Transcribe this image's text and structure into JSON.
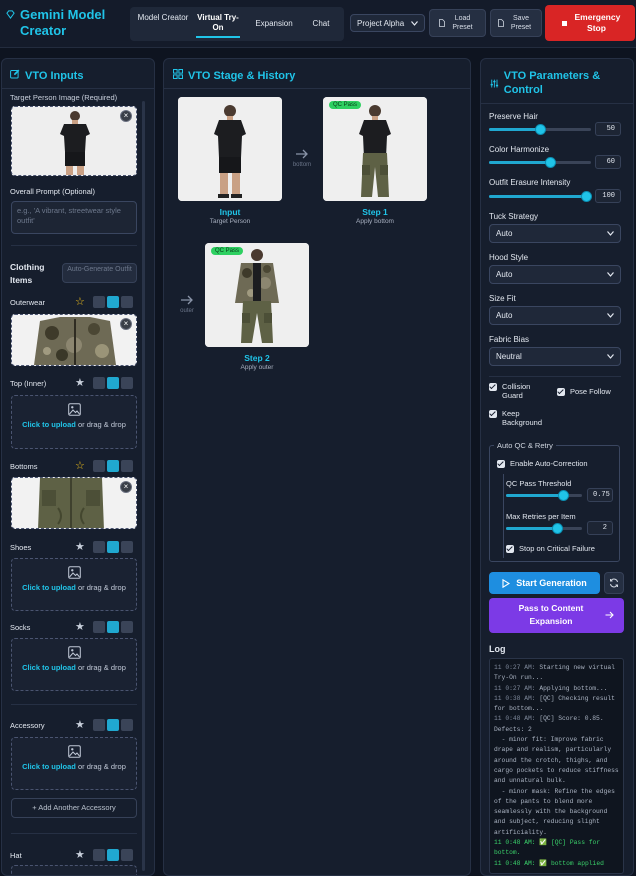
{
  "header": {
    "app_title": "Gemini Model Creator",
    "tabs": [
      {
        "label": "Model Creator"
      },
      {
        "label": "Virtual Try-On"
      },
      {
        "label": "Expansion"
      },
      {
        "label": "Chat"
      }
    ],
    "active_tab": "Virtual Try-On",
    "project_select": "Project Alpha",
    "load_preset": "Load Preset",
    "save_preset": "Save Preset",
    "emergency_stop": "Emergency Stop"
  },
  "inputs": {
    "title": "VTO Inputs",
    "target_label": "Target Person Image (Required)",
    "prompt_label": "Overall Prompt (Optional)",
    "prompt_placeholder": "e.g., 'A vibrant, streetwear style outfit'",
    "clothing_title": "Clothing Items",
    "auto_generate": "Auto-Generate Outfit",
    "upload_link": "Click to upload",
    "upload_rest": " or drag & drop",
    "add_accessory": "+ Add Another Accessory",
    "items": [
      {
        "name": "Outerwear",
        "starred": true,
        "has_image": true
      },
      {
        "name": "Top (Inner)",
        "starred": false,
        "has_image": false
      },
      {
        "name": "Bottoms",
        "starred": true,
        "has_image": true
      },
      {
        "name": "Shoes",
        "starred": false,
        "has_image": false
      },
      {
        "name": "Socks",
        "starred": false,
        "has_image": false
      },
      {
        "name": "Accessory",
        "starred": false,
        "has_image": false
      },
      {
        "name": "Hat",
        "starred": false,
        "has_image": false
      }
    ]
  },
  "stage": {
    "title": "VTO Stage & History",
    "qc_badge": "QC Pass",
    "steps": [
      {
        "caption": "Input",
        "sub": "Target Person",
        "connector": "bottom"
      },
      {
        "caption": "Step 1",
        "sub": "Apply bottom",
        "connector": "outer"
      },
      {
        "caption": "Step 2",
        "sub": "Apply outer",
        "connector": ""
      }
    ]
  },
  "params": {
    "title": "VTO Parameters & Control",
    "sliders": [
      {
        "label": "Preserve Hair",
        "value": "50",
        "fraction": 0.5
      },
      {
        "label": "Color Harmonize",
        "value": "60",
        "fraction": 0.6
      },
      {
        "label": "Outfit Erasure Intensity",
        "value": "100",
        "fraction": 1.0
      }
    ],
    "selects": [
      {
        "label": "Tuck Strategy",
        "value": "Auto"
      },
      {
        "label": "Hood Style",
        "value": "Auto"
      },
      {
        "label": "Size Fit",
        "value": "Auto"
      },
      {
        "label": "Fabric Bias",
        "value": "Neutral"
      }
    ],
    "checks": {
      "collision": "Collision Guard",
      "pose": "Pose Follow",
      "keep_bg": "Keep Background"
    },
    "auto_qc": {
      "legend": "Auto QC & Retry",
      "enable": "Enable Auto-Correction",
      "threshold_label": "QC Pass Threshold",
      "threshold_value": "0.75",
      "threshold_fraction": 0.75,
      "retries_label": "Max Retries per Item",
      "retries_value": "2",
      "retries_fraction": 0.67,
      "stop_critical": "Stop on Critical Failure"
    },
    "start": "Start Generation",
    "pass": "Pass to Content Expansion",
    "log_title": "Log"
  },
  "log": [
    {
      "ts": "11 0:27 AM:",
      "text": " Starting new virtual Try-On run...",
      "green": false
    },
    {
      "ts": "11 0:27 AM:",
      "text": " Applying bottom...",
      "green": false
    },
    {
      "ts": "11 0:38 AM:",
      "text": " [QC] Checking result for bottom...",
      "green": false
    },
    {
      "ts": "11 0:48 AM:",
      "text": " [QC] Score: 0.85. Defects: 2",
      "green": false
    },
    {
      "ts": "",
      "text": "  - minor fit: Improve fabric drape and realism, particularly around the crotch, thighs, and cargo pockets to reduce stiffness and unnatural bulk.",
      "green": false
    },
    {
      "ts": "",
      "text": "  - minor mask: Refine the edges of the pants to blend more seamlessly with the background and subject, reducing slight artificiality.",
      "green": false
    },
    {
      "ts": "11 0:48 AM:",
      "text": " ✅ [QC] Pass for bottom.",
      "green": true
    },
    {
      "ts": "11 0:48 AM:",
      "text": " ✅ bottom applied",
      "green": true
    }
  ],
  "colors": {
    "accent": "#20c4e8",
    "danger": "#d92525",
    "purple": "#7c3ae6",
    "qc": "#2ed061"
  }
}
